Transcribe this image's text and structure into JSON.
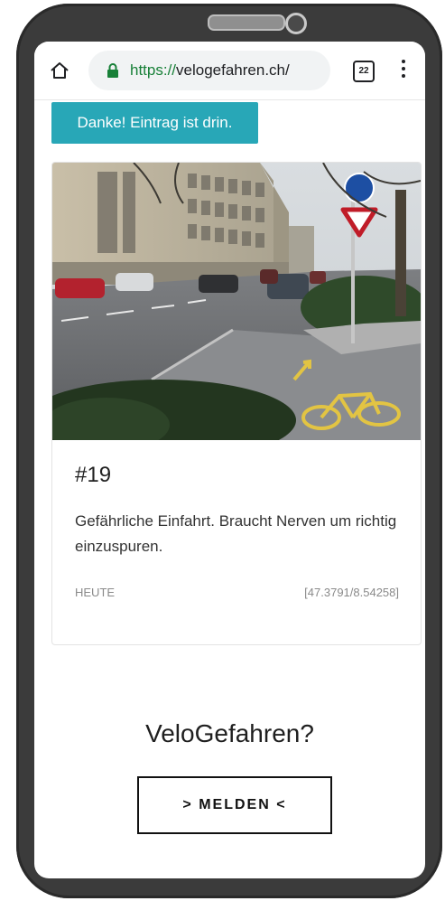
{
  "browser": {
    "url_scheme": "https://",
    "url_host": "velogefahren.ch/",
    "tab_count": "22",
    "icons": {
      "home": "home-icon",
      "lock": "lock-icon",
      "tabs": "tab-switcher-icon",
      "menu": "more-vert-icon"
    }
  },
  "toast": {
    "message": "Danke! Eintrag ist drin.",
    "color": "#28a7b7"
  },
  "entry": {
    "number": "#19",
    "description": "Gefährliche Einfahrt. Braucht Nerven um richtig einzuspuren.",
    "date": "HEUTE",
    "coordinates": "[47.3791/8.54258]"
  },
  "cta": {
    "heading": "VeloGefahren?",
    "button_label": "> MELDEN <"
  }
}
